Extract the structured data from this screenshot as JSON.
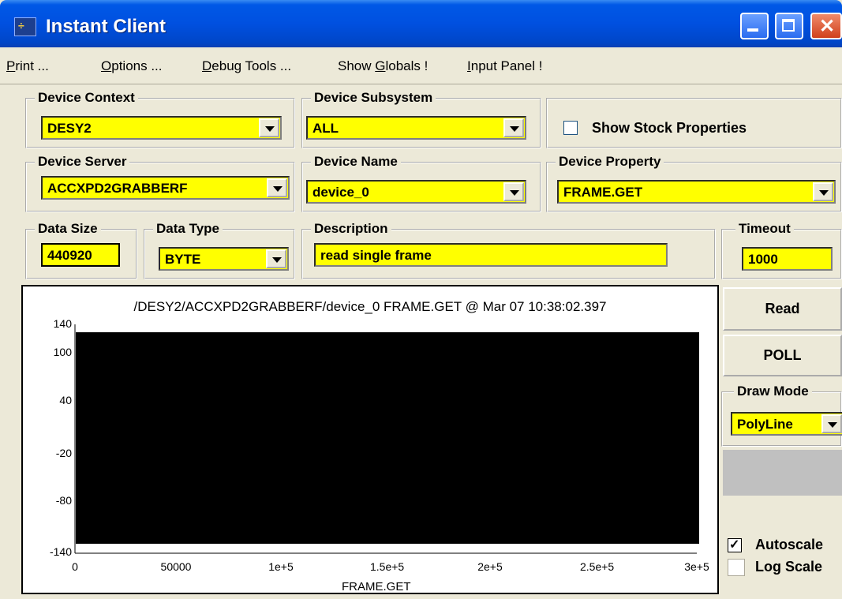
{
  "window": {
    "title": "Instant Client",
    "app_icon": "instant-client-icon"
  },
  "menu": {
    "items": [
      {
        "pre": "",
        "u": "P",
        "post": "rint ..."
      },
      {
        "pre": "",
        "u": "O",
        "post": "ptions ..."
      },
      {
        "pre": "",
        "u": "D",
        "post": "ebug Tools ..."
      },
      {
        "pre": "Show ",
        "u": "G",
        "post": "lobals !"
      },
      {
        "pre": "",
        "u": "I",
        "post": "nput Panel !"
      }
    ]
  },
  "groups": {
    "device_context": {
      "label": "Device Context",
      "value": "DESY2"
    },
    "device_subsystem": {
      "label": "Device Subsystem",
      "value": "ALL"
    },
    "show_stock_properties": {
      "label": "Show Stock Properties",
      "checked": false
    },
    "device_server": {
      "label": "Device Server",
      "value": "ACCXPD2GRABBERF"
    },
    "device_name": {
      "label": "Device Name",
      "value": "device_0"
    },
    "device_property": {
      "label": "Device Property",
      "value": "FRAME.GET"
    },
    "data_size": {
      "label": "Data Size",
      "value": "440920"
    },
    "data_type": {
      "label": "Data Type",
      "value": "BYTE"
    },
    "description": {
      "label": "Description",
      "value": "read single frame"
    },
    "timeout": {
      "label": "Timeout",
      "value": "1000"
    },
    "draw_mode": {
      "label": "Draw Mode",
      "value": "PolyLine"
    }
  },
  "buttons": {
    "read": "Read",
    "poll": "POLL"
  },
  "checkboxes": {
    "autoscale": {
      "label": "Autoscale",
      "checked": true
    },
    "log_scale": {
      "label": "Log Scale",
      "checked": false
    }
  },
  "plot": {
    "title": "/DESY2/ACCXPD2GRABBERF/device_0 FRAME.GET @ Mar 07 10:38:02.397",
    "xlabel": "FRAME.GET",
    "y_ticks": [
      "140",
      "100",
      "40",
      "-20",
      "-80",
      "-140"
    ],
    "x_ticks": [
      "0",
      "50000",
      "1e+5",
      "1.5e+5",
      "2e+5",
      "2.5e+5",
      "3e+5"
    ]
  },
  "colors": {
    "field_bg": "#ffff00",
    "window_bg": "#ece9d8",
    "title_bar": "#0050e0"
  }
}
